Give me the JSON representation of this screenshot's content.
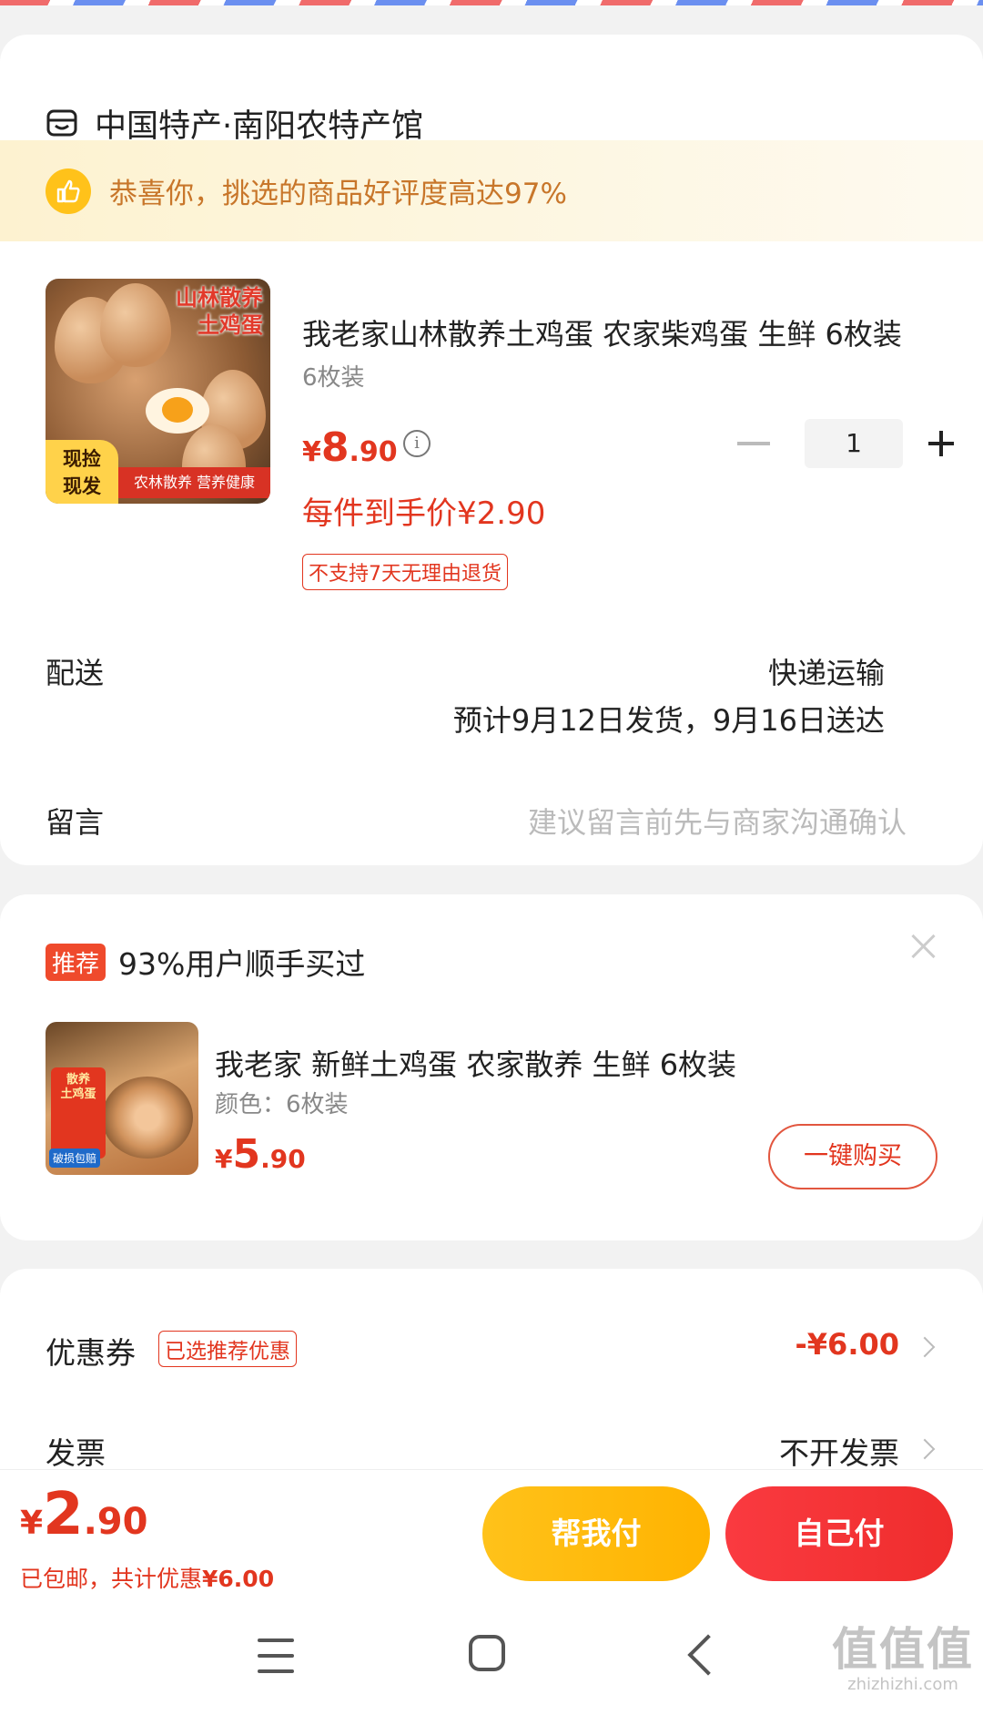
{
  "store": {
    "name": "中国特产·南阳农特产馆"
  },
  "praise": {
    "text": "恭喜你，挑选的商品好评度高达97%"
  },
  "product": {
    "image_title_line1": "山林散养",
    "image_title_line2": "土鸡蛋",
    "image_tag_line1": "现捡",
    "image_tag_line2": "现发",
    "image_strip": "农林散养 营养健康",
    "title": "我老家山林散养土鸡蛋 农家柴鸡蛋 生鲜 6枚装",
    "spec": "6枚装",
    "price_symbol": "¥",
    "price_int": "8",
    "price_dec": ".90",
    "unit_price": "每件到手价¥2.90",
    "no_return": "不支持7天无理由退货",
    "quantity": "1"
  },
  "shipping": {
    "label": "配送",
    "method": "快递运输",
    "eta": "预计9月12日发货，9月16日送达"
  },
  "message": {
    "label": "留言",
    "placeholder": "建议留言前先与商家沟通确认"
  },
  "recommend": {
    "tag": "推荐",
    "title": "93%用户顺手买过",
    "image_badge_line1": "散养",
    "image_badge_line2": "土鸡蛋",
    "image_chip": "破损包赔",
    "name": "我老家 新鲜土鸡蛋 农家散养 生鲜 6枚装",
    "spec": "颜色：6枚装",
    "price_symbol": "¥",
    "price_int": "5",
    "price_dec": ".90",
    "buy_label": "一键购买"
  },
  "coupon": {
    "label": "优惠券",
    "tag": "已选推荐优惠",
    "value": "-¥6.00"
  },
  "invoice": {
    "label": "发票",
    "value": "不开发票"
  },
  "checkout": {
    "total_symbol": "¥",
    "total_int": "2",
    "total_dec": ".90",
    "note_prefix": "已包邮，共计优惠",
    "note_discount": "¥6.00",
    "help_pay_label": "帮我付",
    "self_pay_label": "自己付"
  },
  "watermark": {
    "big": "值值值",
    "small": "zhizhizhi.com"
  },
  "colors": {
    "accent": "#e2361f",
    "yellow": "#ffc21a",
    "red_button": "#f43636"
  }
}
